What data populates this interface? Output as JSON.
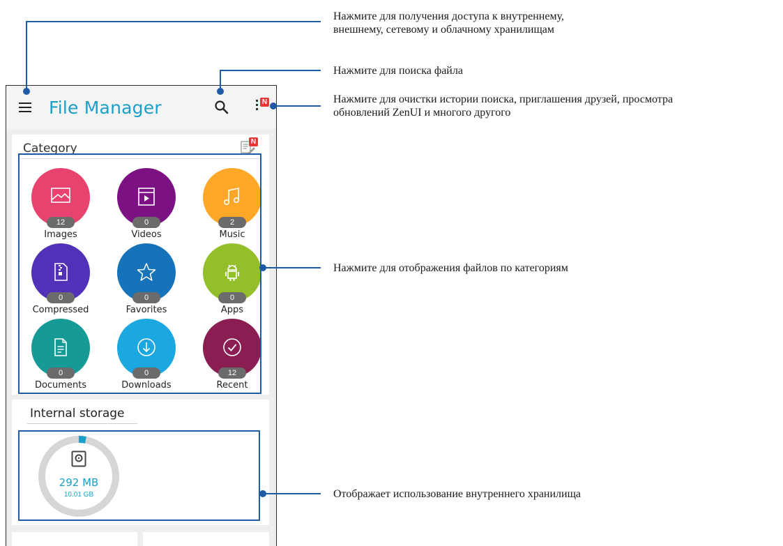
{
  "app": {
    "title": "File Manager",
    "badge": "N"
  },
  "category": {
    "title": "Category",
    "badge": "N",
    "items": [
      {
        "label": "Images",
        "count": "12",
        "color": "#e8436e",
        "icon": "image-icon"
      },
      {
        "label": "Videos",
        "count": "0",
        "color": "#7b1183",
        "icon": "video-icon"
      },
      {
        "label": "Music",
        "count": "2",
        "color": "#ffa726",
        "icon": "music-icon"
      },
      {
        "label": "Compressed",
        "count": "0",
        "color": "#5131b8",
        "icon": "zip-icon"
      },
      {
        "label": "Favorites",
        "count": "0",
        "color": "#1673b9",
        "icon": "star-icon"
      },
      {
        "label": "Apps",
        "count": "0",
        "color": "#93c02a",
        "icon": "android-icon"
      },
      {
        "label": "Documents",
        "count": "0",
        "color": "#159a96",
        "icon": "document-icon"
      },
      {
        "label": "Downloads",
        "count": "0",
        "color": "#1ba8e0",
        "icon": "download-icon"
      },
      {
        "label": "Recent",
        "count": "12",
        "color": "#8a1d52",
        "icon": "check-circle-icon"
      }
    ]
  },
  "storage": {
    "title": "Internal storage",
    "used": "292 MB",
    "total": "10.01 GB",
    "used_fraction": 0.03,
    "ring_color": "#d6d6d6",
    "used_color": "#1aa0c8"
  },
  "annotations": [
    {
      "lines": [
        "Нажмите для получения доступа к внутреннему,",
        "внешнему, сетевому и облачному хранилищам"
      ]
    },
    {
      "lines": [
        "Нажмите для поиска файла"
      ]
    },
    {
      "lines": [
        "Нажмите для очистки истории поиска, приглашения друзей, просмотра",
        "обновлений ZenUI и многого другого"
      ]
    },
    {
      "lines": [
        "Нажмите для отображения файлов по категориям"
      ]
    },
    {
      "lines": [
        "Отображает использование внутреннего хранилища"
      ]
    }
  ],
  "colors": {
    "accent": "#1aa0c8",
    "callout": "#1f5aa6",
    "badge": "#e53935"
  }
}
